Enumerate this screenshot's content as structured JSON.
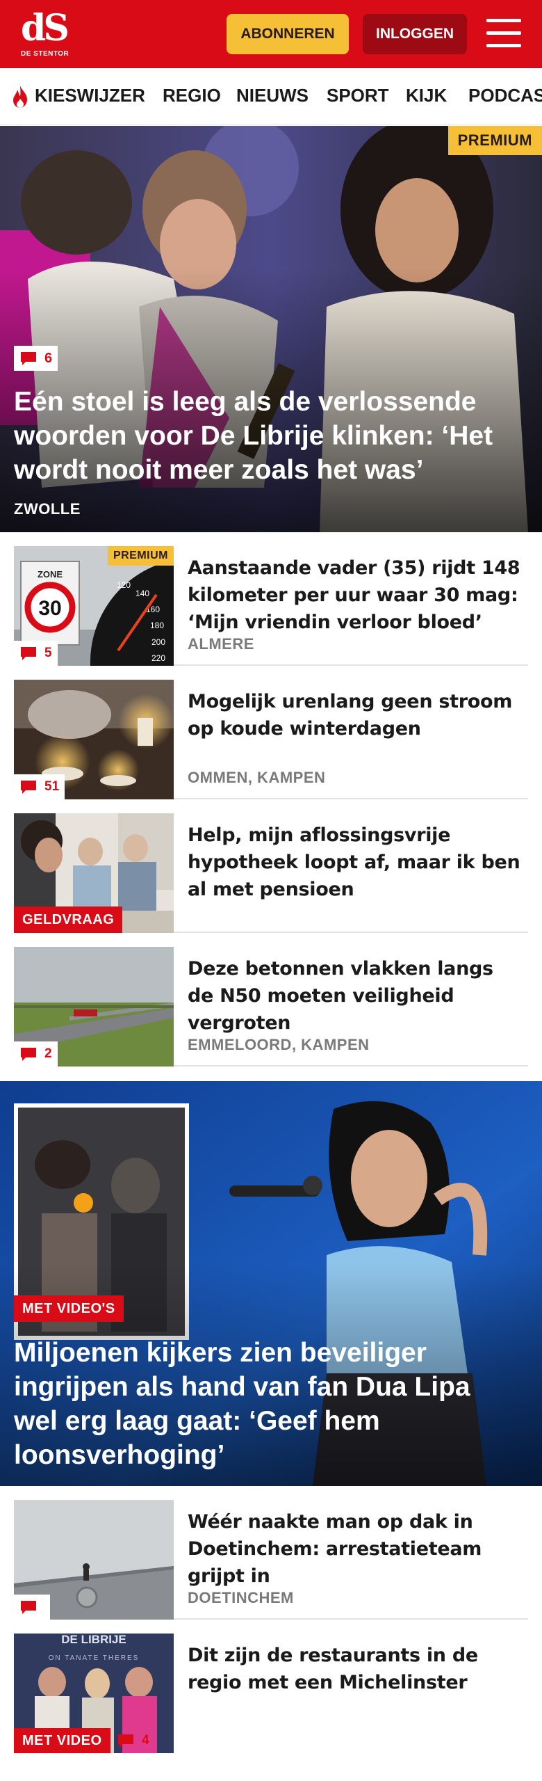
{
  "header": {
    "logo_mark": "dS",
    "logo_sub": "DE STENTOR",
    "subscribe_label": "ABONNEREN",
    "login_label": "INLOGGEN",
    "brand_color": "#d90b16",
    "accent_color": "#f5c036"
  },
  "nav": {
    "items": [
      {
        "label": "KIESWIJZER",
        "icon": "flame-icon"
      },
      {
        "label": "REGIO"
      },
      {
        "label": "NIEUWS"
      },
      {
        "label": "SPORT"
      },
      {
        "label": "KIJK"
      },
      {
        "label": "PODCAS"
      }
    ]
  },
  "hero1": {
    "premium": "PREMIUM",
    "comments": "6",
    "title": "Eén stoel is leeg als de verlossende woorden voor De Librije klinken: ‘Het wordt nooit meer zoals het was’",
    "location": "ZWOLLE"
  },
  "articles": [
    {
      "premium": "PREMIUM",
      "comments": "5",
      "title": "Aanstaande vader (35) rijdt 148 kilometer per uur waar 30 mag: ‘Mijn vriendin verloor bloed’",
      "location": "ALMERE",
      "sign_top": "ZONE",
      "sign_value": "30",
      "speedo": [
        "120",
        "140",
        "160",
        "180",
        "200",
        "220"
      ]
    },
    {
      "comments": "51",
      "title": "Mogelijk urenlang geen stroom op koude winterdagen",
      "location": "OMMEN, KAMPEN"
    },
    {
      "label": "GELDVRAAG",
      "title": "Help, mijn aflossingsvrije hypotheek loopt af, maar ik ben al met pensioen",
      "location": ""
    },
    {
      "comments": "2",
      "title": "Deze betonnen vlakken langs de N50 moeten veiligheid vergroten",
      "location": "EMMELOORD, KAMPEN"
    }
  ],
  "hero2": {
    "label": "MET VIDEO'S",
    "title": "Miljoenen kijkers zien beveiliger ingrijpen als hand van fan Dua Lipa wel erg laag gaat: ‘Geef hem loonsverhoging’"
  },
  "articles2": [
    {
      "comments": "",
      "title": "Wéér naakte man op dak in Doetinchem: arrestatieteam grijpt in",
      "location": "DOETINCHEM"
    },
    {
      "label": "MET VIDEO",
      "comments": "4",
      "title": "Dit zijn de restaurants in de regio met een Michelinster",
      "location": "",
      "thumb_text": "DE LIBRIJE",
      "thumb_subtext": "ON TANATE THERES"
    }
  ]
}
